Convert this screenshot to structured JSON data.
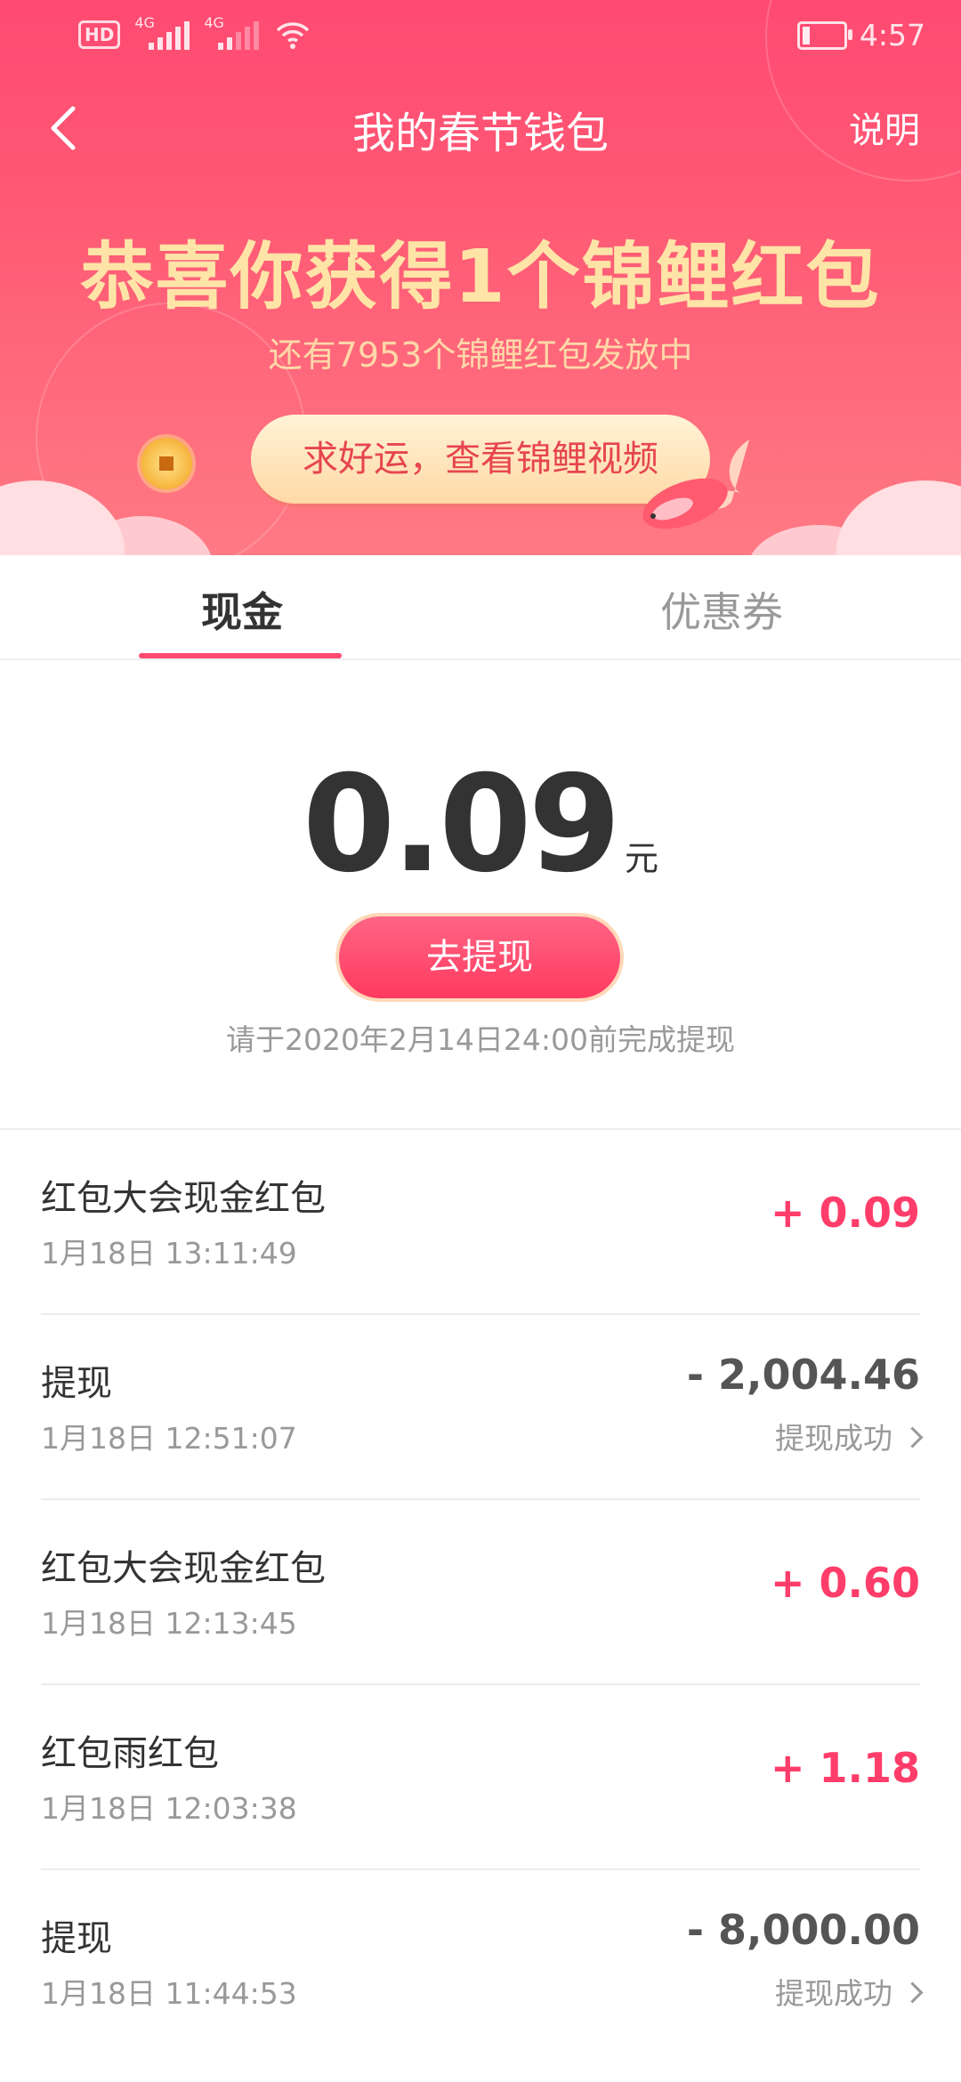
{
  "status_bar": {
    "hd": "HD",
    "sim1_label": "4G",
    "sim2_label": "4G",
    "time": "4:57"
  },
  "nav": {
    "title": "我的春节钱包",
    "help_label": "说明"
  },
  "banner": {
    "headline": "恭喜你获得1个锦鲤红包",
    "subline": "还有7953个锦鲤红包发放中",
    "cta_label": "求好运，查看锦鲤视频"
  },
  "tabs": [
    {
      "label": "现金",
      "active": true
    },
    {
      "label": "优惠券",
      "active": false
    }
  ],
  "balance": {
    "amount": "0.09",
    "unit": "元",
    "withdraw_label": "去提现",
    "deadline": "请于2020年2月14日24:00前完成提现"
  },
  "transactions": [
    {
      "title": "红包大会现金红包",
      "time": "1月18日 13:11:49",
      "amount": "+ 0.09",
      "type": "pos"
    },
    {
      "title": "提现",
      "time": "1月18日 12:51:07",
      "amount": "- 2,004.46",
      "type": "neg",
      "status": "提现成功"
    },
    {
      "title": "红包大会现金红包",
      "time": "1月18日 12:13:45",
      "amount": "+ 0.60",
      "type": "pos"
    },
    {
      "title": "红包雨红包",
      "time": "1月18日 12:03:38",
      "amount": "+ 1.18",
      "type": "pos"
    },
    {
      "title": "提现",
      "time": "1月18日 11:44:53",
      "amount": "- 8,000.00",
      "type": "neg",
      "status": "提现成功"
    }
  ],
  "colors": {
    "brand": "#ff4a72",
    "gold_text": "#ffe4a7",
    "positive": "#ff3d6a",
    "negative": "#555555"
  }
}
